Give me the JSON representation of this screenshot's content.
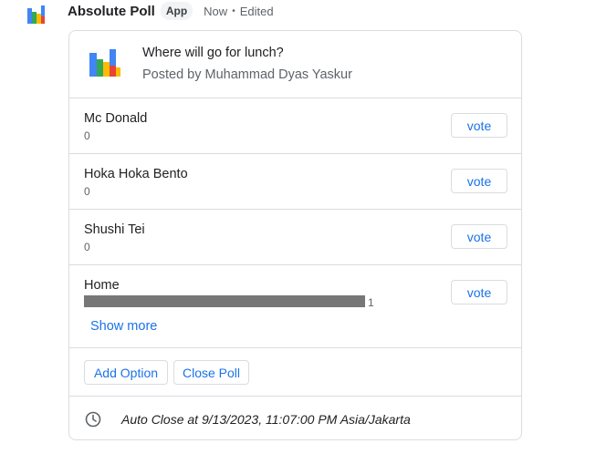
{
  "app": {
    "name": "Absolute Poll",
    "badge": "App",
    "time": "Now",
    "separator": "•",
    "status": "Edited",
    "logo_icon": "bar-chart-logo-icon",
    "colors": {
      "blue": "#4285f4",
      "green": "#34a853",
      "yellow": "#fbbc04",
      "red": "#ea4335"
    }
  },
  "poll": {
    "title": "Where will go for lunch?",
    "posted_by": "Posted by Muhammad Dyas Yaskur",
    "vote_label": "vote",
    "options": [
      {
        "name": "Mc Donald",
        "count": "0"
      },
      {
        "name": "Hoka Hoka Bento",
        "count": "0"
      },
      {
        "name": "Shushi Tei",
        "count": "0"
      },
      {
        "name": "Home",
        "count": "1",
        "bar_fraction": 1.0
      }
    ],
    "show_more": "Show more",
    "add_option": "Add Option",
    "close_poll": "Close Poll",
    "auto_close": "Auto Close at 9/13/2023, 11:07:00 PM Asia/Jakarta",
    "accent_color": "#1a73e8"
  }
}
